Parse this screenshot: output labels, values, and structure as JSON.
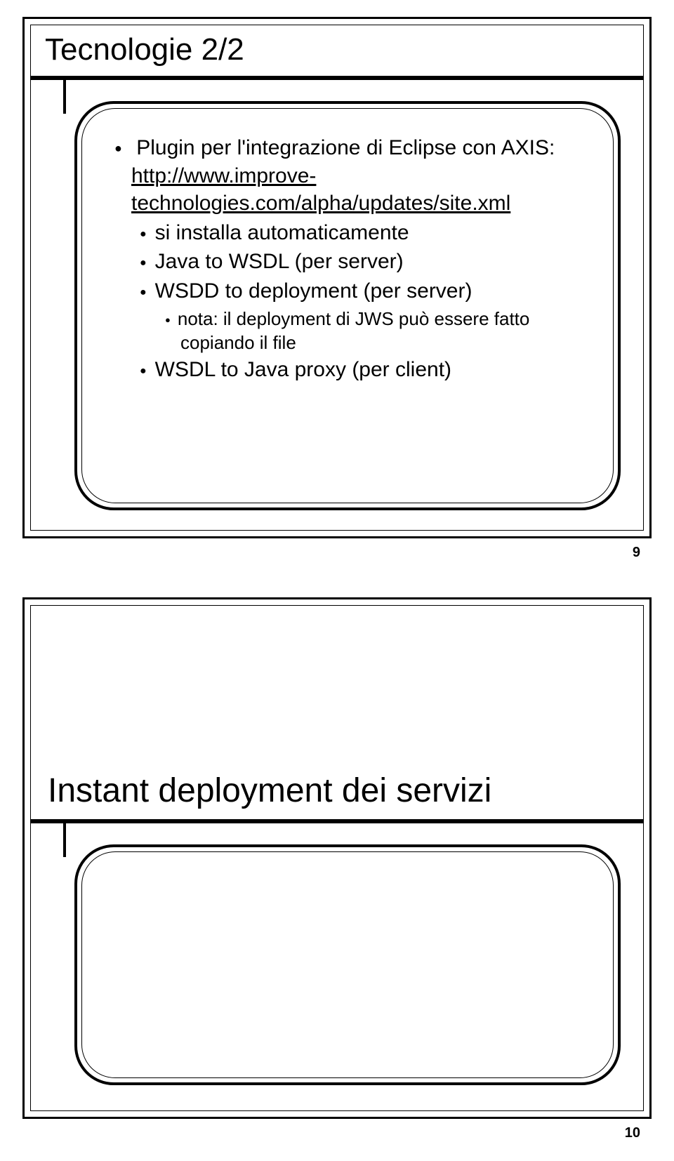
{
  "slide1": {
    "title": "Tecnologie 2/2",
    "bullets": {
      "b1a": "Plugin per l'integrazione di Eclipse con AXIS: ",
      "b1a_link": "http://www.improve-technologies.com/alpha/updates/site.xml",
      "b2a": "si installa automaticamente",
      "b2b": "Java to WSDL (per server)",
      "b2c": "WSDD to deployment (per server)",
      "b3a": "nota: il deployment di JWS può essere fatto copiando il file",
      "b2d": "WSDL to Java proxy (per client)"
    },
    "page": "9"
  },
  "slide2": {
    "title": "Instant deployment dei servizi",
    "page": "10"
  }
}
